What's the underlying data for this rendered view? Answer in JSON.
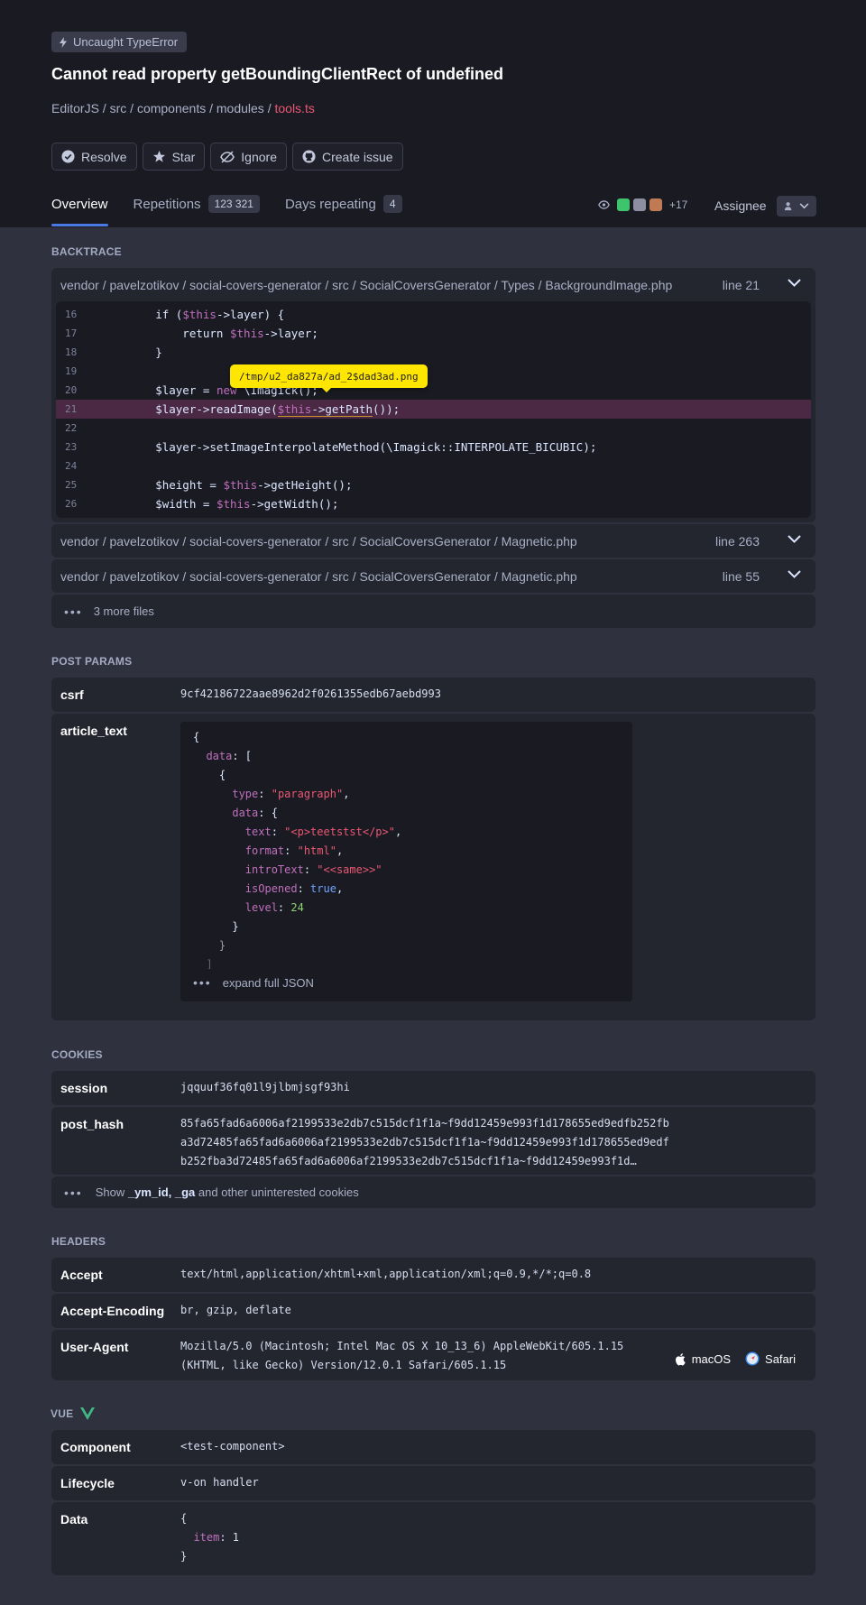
{
  "header": {
    "badge": "Uncaught TypeError",
    "title": "Cannot read property getBoundingClientRect of undefined",
    "breadcrumb": [
      "EditorJS",
      "src",
      "components",
      "modules"
    ],
    "breadcrumb_current": "tools.ts",
    "actions": {
      "resolve": "Resolve",
      "star": "Star",
      "ignore": "Ignore",
      "create_issue": "Create issue"
    },
    "tabs": {
      "overview": "Overview",
      "repetitions": "Repetitions",
      "repetitions_count": "123 321",
      "days": "Days repeating",
      "days_count": "4"
    },
    "watchers_more": "+17",
    "assignee": "Assignee"
  },
  "backtrace": {
    "title": "BACKTRACE",
    "files": [
      {
        "path": "vendor / pavelzotikov / social-covers-generator / src / SocialCoversGenerator / Types / BackgroundImage.php",
        "line": "line 21"
      },
      {
        "path": "vendor / pavelzotikov / social-covers-generator / src / SocialCoversGenerator / Magnetic.php",
        "line": "line 263"
      },
      {
        "path": "vendor / pavelzotikov / social-covers-generator / src / SocialCoversGenerator / Magnetic.php",
        "line": "line 55"
      }
    ],
    "code_lines": [
      "16",
      "17",
      "18",
      "19",
      "20",
      "21",
      "22",
      "23",
      "24",
      "25",
      "26"
    ],
    "tooltip": "/tmp/u2_da827a/ad_2$dad3ad.png",
    "more_files": "3 more files"
  },
  "post_params": {
    "title": "POST PARAMS",
    "csrf_key": "csrf",
    "csrf_value": "9cf42186722aae8962d2f0261355edb67aebd993",
    "article_key": "article_text",
    "expand": "expand full JSON"
  },
  "cookies": {
    "title": "COOKIES",
    "session_key": "session",
    "session_value": "jqquuf36fq01l9jlbmjsgf93hi",
    "hash_key": "post_hash",
    "hash_lines": [
      "85fa65fad6a6006af2199533e2db7c515dcf1f1a~f9dd12459e993f1d178655ed9edfb252fb",
      "a3d72485fa65fad6a6006af2199533e2db7c515dcf1f1a~f9dd12459e993f1d178655ed9edf",
      "b252fba3d72485fa65fad6a6006af2199533e2db7c515dcf1f1a~f9dd12459e993f1d…"
    ],
    "show_prefix": "Show ",
    "show_bold": "_ym_id, _ga",
    "show_suffix": " and other uninterested cookies"
  },
  "headers": {
    "title": "HEADERS",
    "accept_key": "Accept",
    "accept_value": "text/html,application/xhtml+xml,application/xml;q=0.9,*/*;q=0.8",
    "encoding_key": "Accept-Encoding",
    "encoding_value": "br, gzip, deflate",
    "ua_key": "User-Agent",
    "ua_line1": "Mozilla/5.0 (Macintosh; Intel Mac OS X 10_13_6) AppleWebKit/605.1.15",
    "ua_line2": "(KHTML, like Gecko) Version/12.0.1 Safari/605.1.15",
    "os": "macOS",
    "browser": "Safari"
  },
  "vue": {
    "title": "VUE",
    "component_key": "Component",
    "component_value": "<test-component>",
    "lifecycle_key": "Lifecycle",
    "lifecycle_value": "v-on handler",
    "data_key": "Data"
  },
  "colors": {
    "accent": "#4979e4",
    "error_red": "#ea5773",
    "tooltip_yellow": "#ffe600",
    "vue_green": "#41b883"
  }
}
